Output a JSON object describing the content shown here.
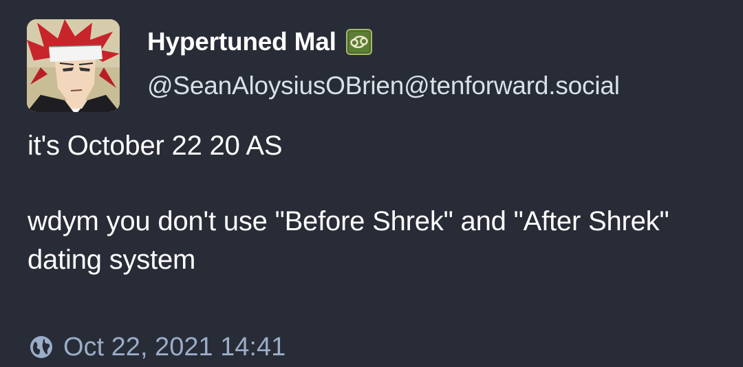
{
  "post": {
    "author": {
      "display_name": "Hypertuned Mal",
      "handle": "@SeanAloysiusOBrien@tenforward.social",
      "custom_emoji": "cancer-zodiac-emoji"
    },
    "content": {
      "paragraphs": [
        "it's October 22 20 AS",
        "wdym you don't use \"Before Shrek\" and \"After Shrek\" dating system"
      ]
    },
    "meta": {
      "visibility_icon": "globe-icon",
      "timestamp": "Oct 22, 2021 14:41"
    }
  },
  "colors": {
    "background": "#282c37",
    "text": "#ffffff",
    "handle": "#d9e1e8",
    "meta": "#9baec8"
  }
}
